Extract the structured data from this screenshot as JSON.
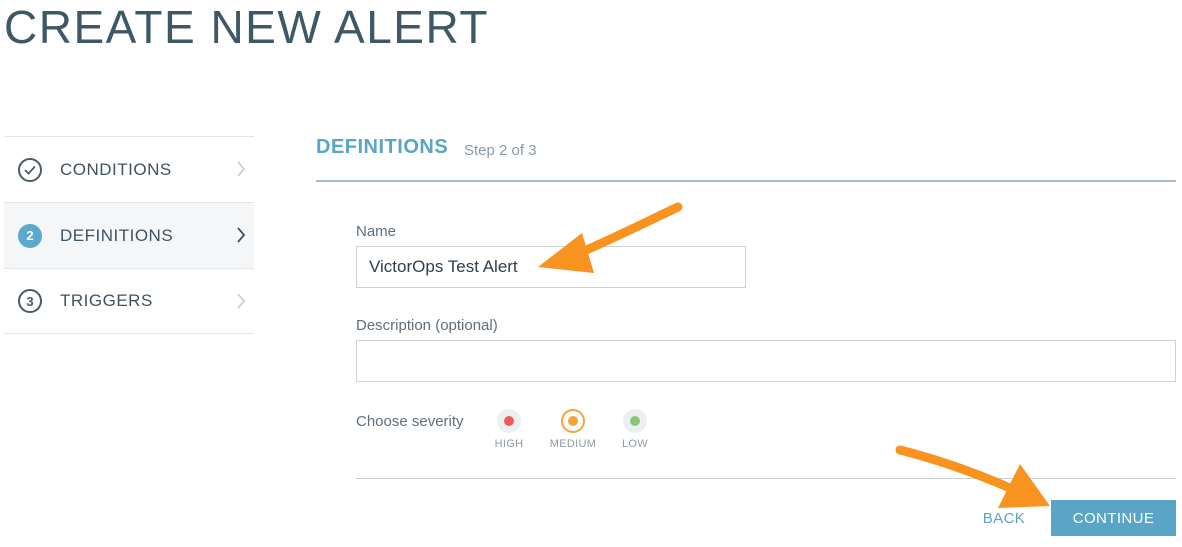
{
  "page": {
    "title": "CREATE NEW ALERT"
  },
  "steps": [
    {
      "number": "✓",
      "label": "CONDITIONS",
      "state": "done",
      "icon": "checkmark-icon"
    },
    {
      "number": "2",
      "label": "DEFINITIONS",
      "state": "active",
      "icon": "step-number-icon"
    },
    {
      "number": "3",
      "label": "TRIGGERS",
      "state": "pending",
      "icon": "step-number-icon"
    }
  ],
  "section": {
    "title": "DEFINITIONS",
    "step_text": "Step 2 of 3"
  },
  "form": {
    "name_label": "Name",
    "name_value": "VictorOps Test Alert",
    "description_label": "Description (optional)",
    "description_value": "",
    "severity_label": "Choose severity",
    "severity_options": [
      {
        "label": "HIGH",
        "color": "#f05a5a"
      },
      {
        "label": "MEDIUM",
        "color": "#f6a23a",
        "selected": true
      },
      {
        "label": "LOW",
        "color": "#86c77a"
      }
    ]
  },
  "actions": {
    "back_label": "BACK",
    "continue_label": "CONTINUE"
  },
  "colors": {
    "accent": "#5aa4c8",
    "annotation_arrow": "#f7931e"
  }
}
